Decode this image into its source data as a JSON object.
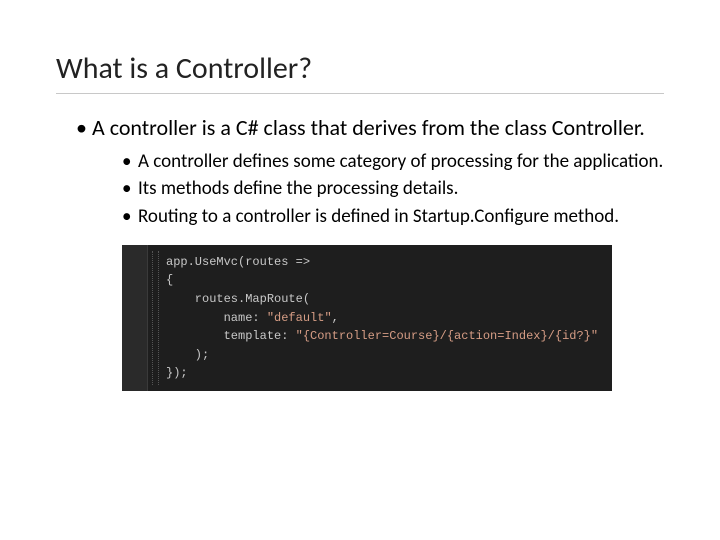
{
  "title": "What is a Controller?",
  "bullets": {
    "l1": "A controller is a C# class that derives from the class Controller.",
    "l2a": "A controller defines some category of processing for the application.",
    "l2b": "Its methods define the processing details.",
    "l2c": "Routing to a controller is defined in Startup.Configure method."
  },
  "code": {
    "line1_a": "app.UseMvc(routes ",
    "line1_b": "=>",
    "line2": "{",
    "line3": "    routes.MapRoute(",
    "line4_a": "        name: ",
    "line4_b": "\"default\"",
    "line4_c": ",",
    "line5_a": "        template: ",
    "line5_b": "\"{Controller=Course}/{action=Index}/{id?}\"",
    "line6": "    );",
    "line7": "});"
  }
}
